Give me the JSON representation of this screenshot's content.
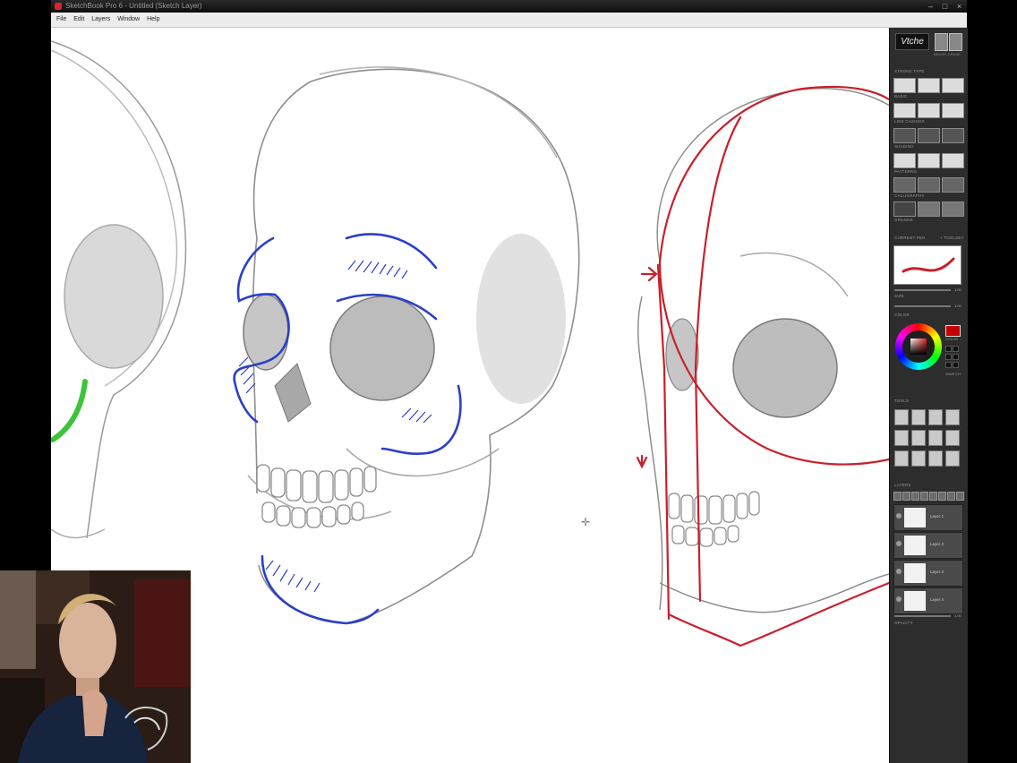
{
  "window": {
    "title": "SketchBook Pro 6 - Untitled (Sketch Layer)"
  },
  "menu": [
    "File",
    "Edit",
    "Layers",
    "Window",
    "Help"
  ],
  "window_controls": {
    "minimize": "–",
    "maximize": "□",
    "close": "×"
  },
  "panel": {
    "logo_text": "Vtche",
    "brush_labels": [
      "BRUSH",
      "ERASE"
    ],
    "sections": {
      "stroke_type": "STROKE TYPE",
      "basic": "BASIC",
      "jaggy_casings": "LINE CASINGS",
      "shading": "SHADING",
      "patterns": "PATTERNS",
      "calligraphy": "CALLIGRAPHY",
      "grunge": "GRUNGE",
      "current_pen": "CURRENT PEN",
      "current_pen_right": "+ TOOLSET",
      "size": "SIZE",
      "opacity": "OPACITY",
      "color": "COLOR",
      "tools": "TOOLS",
      "layers": "LAYERS",
      "layer_opacity": "OPACITY"
    },
    "size_value": "1.00",
    "opacity_value": "1.00",
    "layer_opacity_value": "1.00",
    "color_label": "COLOR",
    "swatches_label": "SWATCH",
    "current_color": "#c40000",
    "layers": [
      "Layer 1",
      "Layer 2",
      "Layer 3",
      "Layer 4"
    ]
  },
  "colors": {
    "blue_stroke": "#2b3fc8",
    "red_stroke": "#c8202a",
    "green_stroke": "#3cc43a",
    "pencil": "#8e8e8e"
  }
}
